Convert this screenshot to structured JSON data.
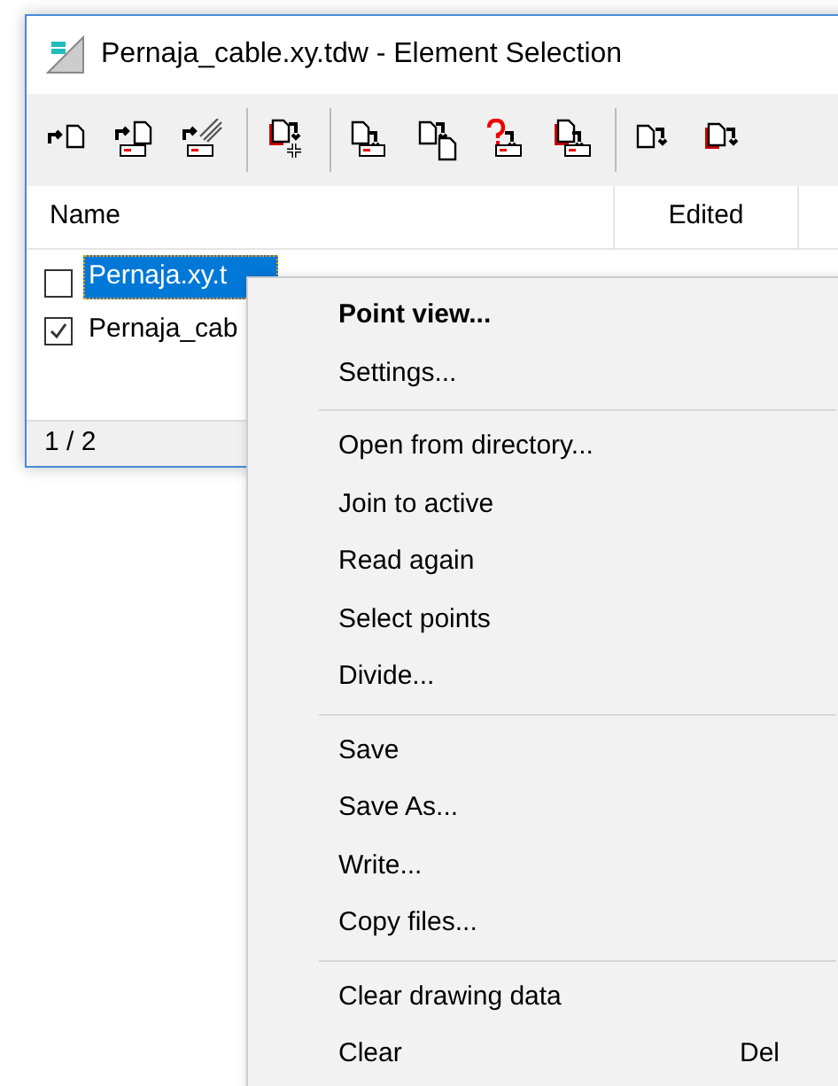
{
  "window": {
    "title": "Pernaja_cable.xy.tdw - Element Selection"
  },
  "table": {
    "columns": [
      "Name",
      "Edited"
    ],
    "rows": [
      {
        "name": "Pernaja.xy.t",
        "checked": false,
        "selected": true
      },
      {
        "name": "Pernaja_cab",
        "checked": true,
        "selected": false
      }
    ]
  },
  "status_bar": "1 / 2",
  "context_menu": {
    "groups": [
      [
        {
          "label": "Point view...",
          "bold": true
        },
        {
          "label": "Settings...",
          "bold": false
        }
      ],
      [
        {
          "label": "Open from directory...",
          "bold": false
        },
        {
          "label": "Join to active",
          "bold": false
        },
        {
          "label": "Read again",
          "bold": false
        },
        {
          "label": "Select points",
          "bold": false
        },
        {
          "label": "Divide...",
          "bold": false
        }
      ],
      [
        {
          "label": "Save",
          "bold": false
        },
        {
          "label": "Save As...",
          "bold": false
        },
        {
          "label": "Write...",
          "bold": false
        },
        {
          "label": "Copy files...",
          "bold": false
        }
      ],
      [
        {
          "label": "Clear drawing data",
          "bold": false
        },
        {
          "label": "Clear",
          "bold": false,
          "shortcut": "Del"
        }
      ]
    ]
  }
}
